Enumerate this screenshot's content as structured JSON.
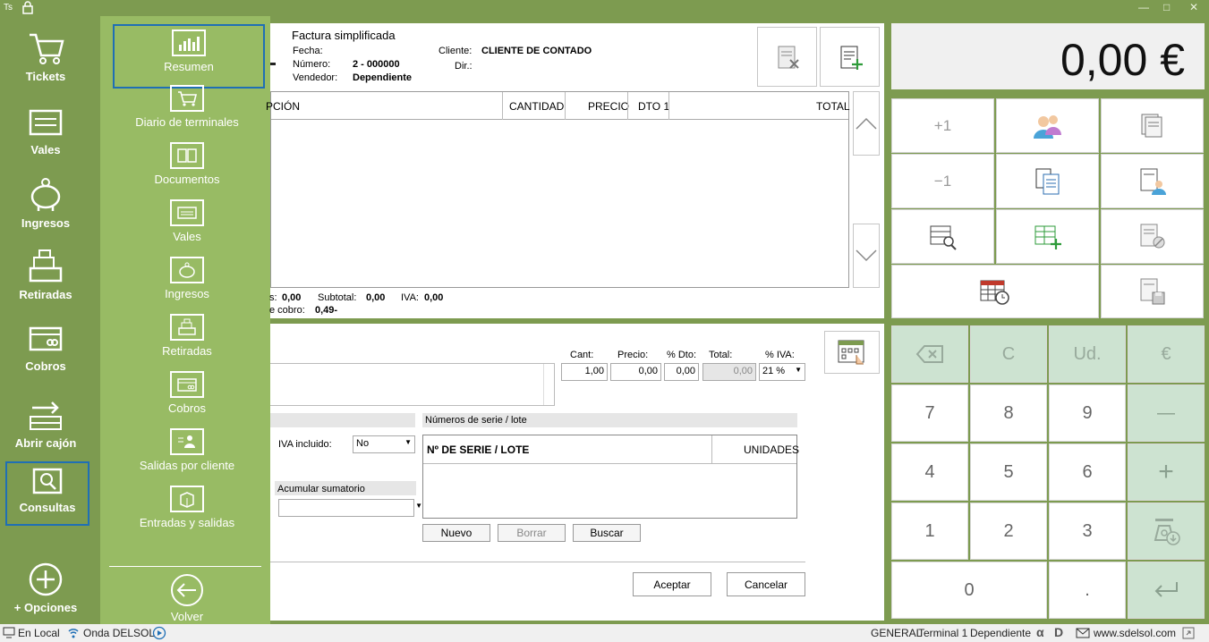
{
  "titlebar": {
    "app_abbrev": "Ts"
  },
  "leftnav": [
    {
      "label": "Tickets"
    },
    {
      "label": "Vales"
    },
    {
      "label": "Ingresos"
    },
    {
      "label": "Retiradas"
    },
    {
      "label": "Cobros"
    },
    {
      "label": "Abrir cajón"
    },
    {
      "label": "Consultas"
    },
    {
      "label": "+ Opciones"
    }
  ],
  "subnav": [
    {
      "label": "Resumen"
    },
    {
      "label": "Diario de terminales"
    },
    {
      "label": "Documentos"
    },
    {
      "label": "Vales"
    },
    {
      "label": "Ingresos"
    },
    {
      "label": "Retiradas"
    },
    {
      "label": "Cobros"
    },
    {
      "label": "Salidas por cliente"
    },
    {
      "label": "Entradas y salidas"
    },
    {
      "label": "Volver"
    }
  ],
  "invoice": {
    "title": "Factura simplificada",
    "fecha_label": "Fecha:",
    "numero_label": "Número:",
    "numero_value": "2 - 000000",
    "vendedor_label": "Vendedor:",
    "vendedor_value": "Dependiente",
    "cliente_label": "Cliente:",
    "cliente_value": "CLIENTE DE CONTADO",
    "dir_label": "Dir.:"
  },
  "grid": {
    "columns": [
      "PCIÓN",
      "CANTIDAD",
      "PRECIO",
      "DTO 1",
      "TOTAL"
    ]
  },
  "totals": {
    "s_label": "s:",
    "s_value": "0,00",
    "subtotal_label": "Subtotal:",
    "subtotal_value": "0,00",
    "iva_label": "IVA:",
    "iva_value": "0,00",
    "cobro_label": "e cobro:",
    "cobro_value": "0,49-"
  },
  "line_editor": {
    "cant_label": "Cant:",
    "cant_value": "1,00",
    "precio_label": "Precio:",
    "precio_value": "0,00",
    "dto_label": "% Dto:",
    "dto_value": "0,00",
    "total_label": "Total:",
    "total_value": "0,00",
    "iva_label": "% IVA:",
    "iva_value": "21 %",
    "iva_incluido_label": "IVA incluido:",
    "iva_incluido_value": "No",
    "acumular_label": "Acumular sumatorio",
    "serie_title": "Números de serie / lote",
    "serie_col1": "Nº DE SERIE / LOTE",
    "serie_col2": "UNIDADES",
    "nuevo": "Nuevo",
    "borrar": "Borrar",
    "buscar": "Buscar",
    "aceptar": "Aceptar",
    "cancelar": "Cancelar"
  },
  "display": {
    "total": "0,00 €"
  },
  "tiles": {
    "plus_one": "+1",
    "minus_one": "−1"
  },
  "keypad": {
    "c": "C",
    "ud": "Ud.",
    "euro": "€",
    "k7": "7",
    "k8": "8",
    "k9": "9",
    "minus": "—",
    "k4": "4",
    "k5": "5",
    "k6": "6",
    "plus": "+",
    "k1": "1",
    "k2": "2",
    "k3": "3",
    "k0": "0",
    "dot": "."
  },
  "statusbar": {
    "en_local": "En Local",
    "onda": "Onda DELSOL",
    "general": "GENERAL",
    "terminal": "Terminal 1",
    "dependiente": "Dependiente",
    "website": "www.sdelsol.com"
  },
  "colors": {
    "sidebar": "#7d9b50",
    "subnav": "#98bb64",
    "keypad_green": "#cde3d1",
    "accent_blue": "#1f6fb5"
  }
}
